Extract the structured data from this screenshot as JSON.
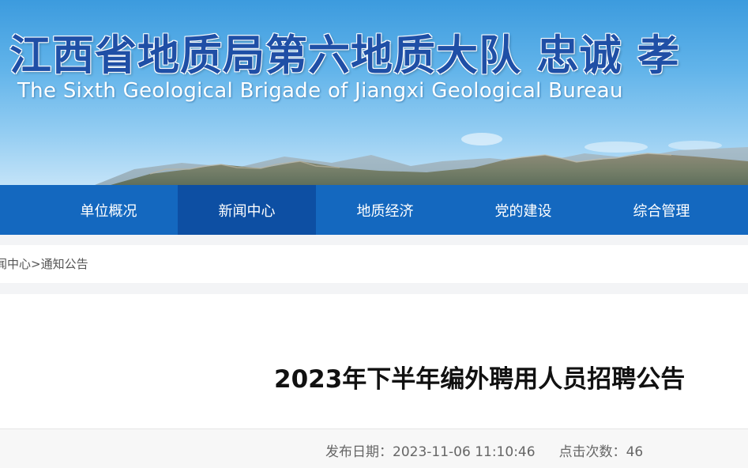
{
  "header": {
    "title": "江西省地质局第六地质大队  忠诚  孝",
    "subtitle": "The Sixth Geological Brigade of Jiangxi Geological Bureau"
  },
  "nav": {
    "items": [
      {
        "label": "单位概况"
      },
      {
        "label": "新闻中心"
      },
      {
        "label": "地质经济"
      },
      {
        "label": "党的建设"
      },
      {
        "label": "综合管理"
      }
    ],
    "active_index": 1
  },
  "breadcrumb": {
    "parent": "闻中心",
    "separator": ">",
    "current": "通知公告"
  },
  "article": {
    "title": "2023年下半年编外聘用人员招聘公告",
    "publish_label": "发布日期：",
    "publish_value": "2023-11-06 11:10:46",
    "views_label": "点击次数：",
    "views_value": "46"
  },
  "colors": {
    "nav_bg": "#1468bf",
    "nav_active_bg": "#0d4fa3",
    "title_blue": "#1f4fa6"
  }
}
